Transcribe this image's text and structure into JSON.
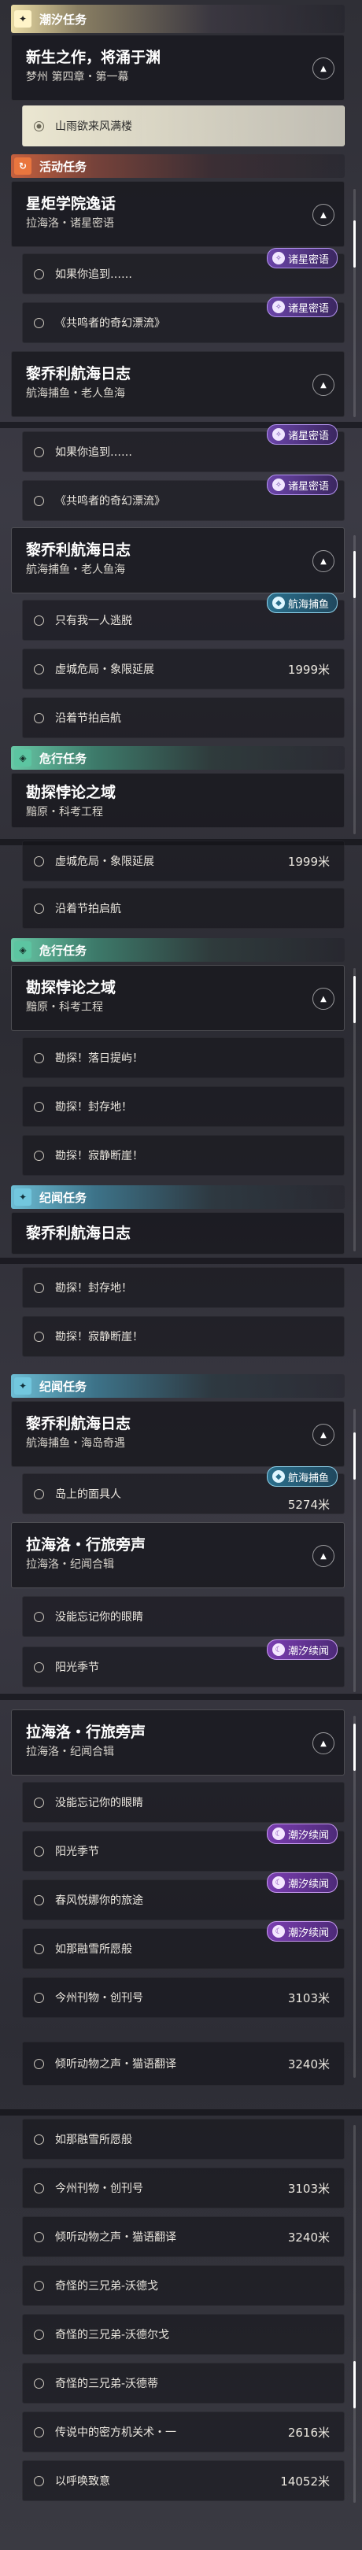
{
  "frame1": {
    "tide_header": "潮汐任务",
    "tide_card": {
      "title": "新生之作，将涌于渊",
      "sub": "梦州 第四章・第一幕"
    },
    "tide_item": "山雨欲来风满楼",
    "act_header": "活动任务",
    "act_card": {
      "title": "星炬学院逸话",
      "sub": "拉海洛・诸星密语"
    },
    "act_items": [
      {
        "label": "如果你追到……",
        "tag": "诸星密语"
      },
      {
        "label": "《共鸣者的奇幻漂流》",
        "tag": "诸星密语"
      }
    ],
    "log_card": {
      "title": "黎乔利航海日志",
      "sub": "航海捕鱼・老人鱼海"
    }
  },
  "frame2": {
    "items_top": [
      {
        "label": "如果你追到……",
        "tag": "诸星密语"
      },
      {
        "label": "《共鸣者的奇幻漂流》",
        "tag": "诸星密语"
      }
    ],
    "log_card": {
      "title": "黎乔利航海日志",
      "sub": "航海捕鱼・老人鱼海"
    },
    "log_items": [
      {
        "label": "只有我一人逃脱",
        "tag": "航海捕鱼"
      },
      {
        "label": "虚城危局・象限延展",
        "dist": "1999米"
      },
      {
        "label": "沿着节拍启航"
      }
    ],
    "risk_header": "危行任务",
    "risk_card": {
      "title": "勘探悖论之域",
      "sub": "黯原・科考工程"
    }
  },
  "frame3": {
    "items_top": [
      {
        "label": "虚城危局・象限延展",
        "dist": "1999米"
      },
      {
        "label": "沿着节拍启航"
      }
    ],
    "risk_header": "危行任务",
    "risk_card": {
      "title": "勘探悖论之域",
      "sub": "黯原・科考工程"
    },
    "risk_items": [
      {
        "label": "勘探！落日提屿！"
      },
      {
        "label": "勘探！封存地！"
      },
      {
        "label": "勘探！寂静断崖！"
      }
    ],
    "log_header": "纪闻任务",
    "log_card": {
      "title": "黎乔利航海日志"
    }
  },
  "frame4": {
    "items_top": [
      {
        "label": "勘探！封存地！"
      },
      {
        "label": "勘探！寂静断崖！"
      }
    ],
    "log_header": "纪闻任务",
    "log_card": {
      "title": "黎乔利航海日志",
      "sub": "航海捕鱼・海岛奇遇"
    },
    "log_items": [
      {
        "label": "岛上的面具人",
        "tag": "航海捕鱼",
        "dist": "5274米"
      }
    ],
    "la_card": {
      "title": "拉海洛・行旅旁声",
      "sub": "拉海洛・纪闻合辑"
    },
    "la_items": [
      {
        "label": "没能忘记你的眼睛"
      },
      {
        "label": "阳光季节",
        "tag": "潮汐续闻"
      }
    ]
  },
  "frame5": {
    "la_card": {
      "title": "拉海洛・行旅旁声",
      "sub": "拉海洛・纪闻合辑"
    },
    "items": [
      {
        "label": "没能忘记你的眼睛"
      },
      {
        "label": "阳光季节",
        "tag": "潮汐续闻"
      },
      {
        "label": "春风悦娜你的旅途",
        "tag": "潮汐续闻"
      },
      {
        "label": "如那融雪所愿般",
        "tag": "潮汐续闻"
      },
      {
        "label": "今州刊物・创刊号",
        "dist": "3103米"
      },
      {
        "label": "倾听动物之声・猫语翻译",
        "dist": "3240米"
      }
    ]
  },
  "frame6": {
    "items": [
      {
        "label": "如那融雪所愿般"
      },
      {
        "label": "今州刊物・创刊号",
        "dist": "3103米"
      },
      {
        "label": "倾听动物之声・猫语翻译",
        "dist": "3240米"
      },
      {
        "label": "奇怪的三兄弟-沃德戈"
      },
      {
        "label": "奇怪的三兄弟-沃德尔戈"
      },
      {
        "label": "奇怪的三兄弟-沃德蒂"
      },
      {
        "label": "传说中的密方机关术・一",
        "dist": "2616米"
      },
      {
        "label": "以呼唤致意",
        "dist": "14052米"
      }
    ]
  }
}
